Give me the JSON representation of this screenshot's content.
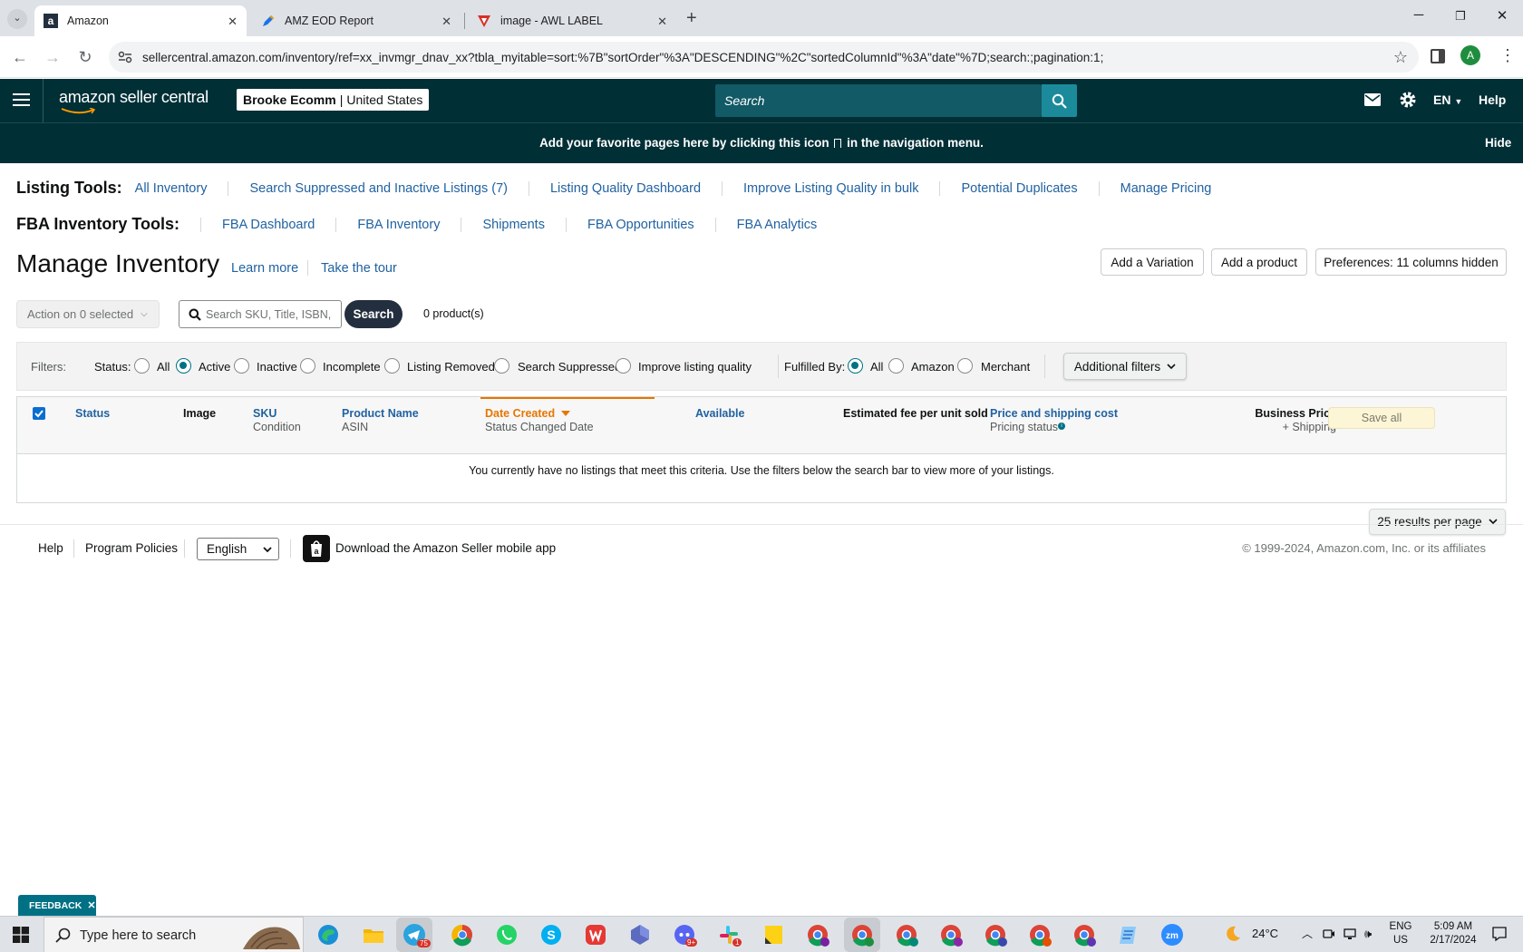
{
  "browser": {
    "tabs": [
      {
        "title": "Amazon"
      },
      {
        "title": "AMZ EOD Report"
      },
      {
        "title": "image - AWL LABEL"
      }
    ],
    "url": "sellercentral.amazon.com/inventory/ref=xx_invmgr_dnav_xx?tbla_myitable=sort:%7B\"sortOrder\"%3A\"DESCENDING\"%2C\"sortedColumnId\"%3A\"date\"%7D;search:;pagination:1;",
    "profile_initial": "A"
  },
  "header": {
    "logo": "amazon seller central",
    "account_name": "Brooke Ecomm",
    "marketplace": "United States",
    "search_placeholder": "Search",
    "language": "EN",
    "help": "Help"
  },
  "favorites_banner": {
    "text_before": "Add your favorite pages here by clicking this icon",
    "text_after": "in the navigation menu.",
    "hide": "Hide"
  },
  "listing_tools": {
    "title": "Listing Tools:",
    "links": [
      "All Inventory",
      "Search Suppressed and Inactive Listings (7)",
      "Listing Quality Dashboard",
      "Improve Listing Quality in bulk",
      "Potential Duplicates",
      "Manage Pricing"
    ]
  },
  "fba_tools": {
    "title": "FBA Inventory Tools:",
    "links": [
      "FBA Dashboard",
      "FBA Inventory",
      "Shipments",
      "FBA Opportunities",
      "FBA Analytics"
    ]
  },
  "page": {
    "title": "Manage Inventory",
    "learn_more": "Learn more",
    "take_tour": "Take the tour",
    "add_variation": "Add a Variation",
    "add_product": "Add a product",
    "preferences": "Preferences: 11 columns hidden"
  },
  "actions": {
    "action_label": "Action on 0 selected",
    "search_placeholder": "Search SKU, Title, ISBN,",
    "search_button": "Search",
    "product_count": "0 product(s)"
  },
  "filters": {
    "label": "Filters:",
    "status_label": "Status:",
    "status_options": [
      "All",
      "Active",
      "Inactive",
      "Incomplete",
      "Listing Removed",
      "Search Suppressed",
      "Improve listing quality"
    ],
    "status_selected": "Active",
    "fulfilled_label": "Fulfilled By:",
    "fulfilled_options": [
      "All",
      "Amazon",
      "Merchant"
    ],
    "fulfilled_selected": "All",
    "additional": "Additional filters"
  },
  "table": {
    "columns": {
      "status": "Status",
      "image": "Image",
      "sku": "SKU",
      "condition": "Condition",
      "product_name": "Product Name",
      "asin": "ASIN",
      "date_created": "Date Created",
      "status_changed": "Status Changed Date",
      "available": "Available",
      "fee": "Estimated fee per unit sold",
      "price": "Price and shipping cost",
      "pricing_status": "Pricing status",
      "business_price": "Business Price",
      "plus_shipping": "+ Shipping"
    },
    "save_all": "Save all",
    "empty_message": "You currently have no listings that meet this criteria. Use the filters below the search bar to view more of your listings.",
    "per_page": "25 results per page"
  },
  "footer": {
    "help": "Help",
    "policies": "Program Policies",
    "language": "English",
    "app": "Download the Amazon Seller mobile app",
    "copyright": "© 1999-2024, Amazon.com, Inc. or its affiliates"
  },
  "feedback": "FEEDBACK",
  "taskbar": {
    "search_placeholder": "Type here to search",
    "weather": "24°C",
    "lang": "ENG",
    "region": "US",
    "time": "5:09 AM",
    "date": "2/17/2024",
    "badges": {
      "telegram": "75",
      "discord": "9+",
      "slack": "1"
    }
  },
  "colors": {
    "header": "#002f36",
    "link": "#2162a1",
    "accent_orange": "#e77600",
    "teal": "#007185"
  }
}
